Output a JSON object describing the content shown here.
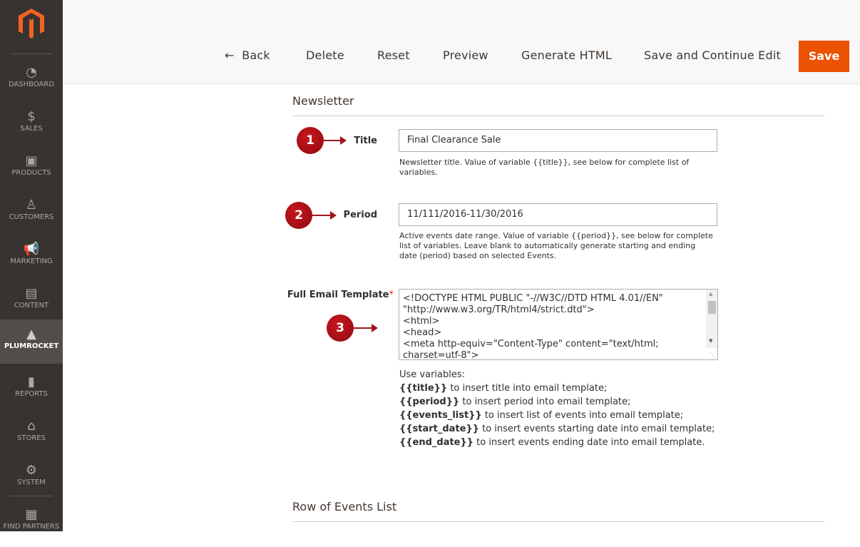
{
  "sidebar": {
    "items": [
      {
        "label": "DASHBOARD",
        "icon": "dashboard-icon"
      },
      {
        "label": "SALES",
        "icon": "dollar-icon"
      },
      {
        "label": "PRODUCTS",
        "icon": "box-icon"
      },
      {
        "label": "CUSTOMERS",
        "icon": "person-icon"
      },
      {
        "label": "MARKETING",
        "icon": "megaphone-icon"
      },
      {
        "label": "CONTENT",
        "icon": "layout-icon"
      },
      {
        "label": "PLUMROCKET",
        "icon": "pyramid-icon",
        "active": true
      },
      {
        "label": "REPORTS",
        "icon": "bar-chart-icon"
      },
      {
        "label": "STORES",
        "icon": "store-icon"
      },
      {
        "label": "SYSTEM",
        "icon": "gear-icon"
      },
      {
        "label": "FIND PARTNERS",
        "icon": "lego-icon"
      }
    ]
  },
  "toolbar": {
    "back": "Back",
    "delete": "Delete",
    "reset": "Reset",
    "preview": "Preview",
    "generate": "Generate HTML",
    "save_continue": "Save and Continue Edit",
    "save": "Save"
  },
  "colors": {
    "accent": "#eb5202",
    "sidebar": "#373330",
    "badge": "#b0121a"
  },
  "form": {
    "section": "Newsletter",
    "title_label": "Title",
    "title_value": "Final Clearance Sale",
    "title_note": "Newsletter title. Value of variable {{title}}, see below for complete list of variables.",
    "period_label": "Period",
    "period_value": "11/111/2016-11/30/2016",
    "period_note": "Active events date range. Value of variable {{period}}, see below for complete list of variables. Leave blank to automatically generate starting and ending date (period) based on selected Events.",
    "template_label": "Full Email Template",
    "required": "*",
    "template_value": "<!DOCTYPE HTML PUBLIC \"-//W3C//DTD HTML 4.01//EN\"\n\"http://www.w3.org/TR/html4/strict.dtd\">\n<html>\n<head>\n<meta http-equiv=\"Content-Type\" content=\"text/html; charset=utf-8\">",
    "vars_heading": "Use variables:",
    "vars": [
      {
        "name": "{{title}}",
        "desc": " to insert title into email template;"
      },
      {
        "name": "{{period}}",
        "desc": " to insert period into email template;"
      },
      {
        "name": "{{events_list}}",
        "desc": " to insert list of events into email template;"
      },
      {
        "name": "{{start_date}}",
        "desc": " to insert events starting date into email template;"
      },
      {
        "name": "{{end_date}}",
        "desc": " to insert events ending date into email template."
      }
    ]
  },
  "badges": [
    "1",
    "2",
    "3"
  ],
  "section2": "Row of Events List"
}
